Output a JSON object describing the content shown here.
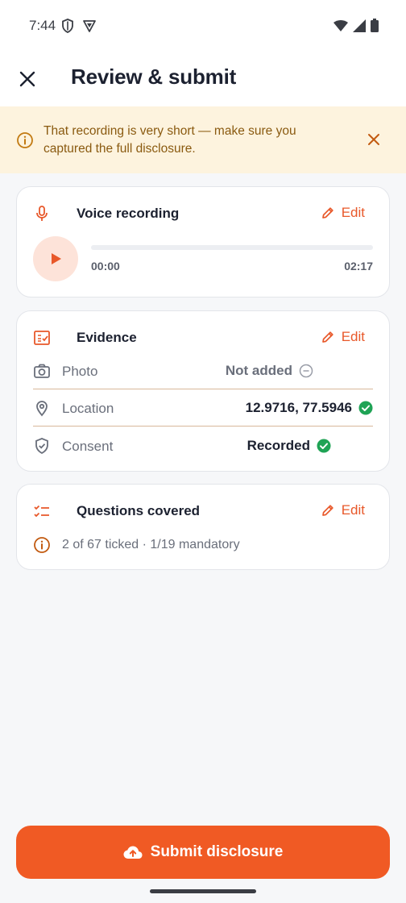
{
  "status_bar": {
    "time": "7:44"
  },
  "header": {
    "title": "Review & submit"
  },
  "banner": {
    "message": "That recording is very short — make sure you captured the full disclosure."
  },
  "voice_card": {
    "title": "Voice recording",
    "edit_label": "Edit",
    "time_elapsed": "00:00",
    "time_total": "02:17",
    "progress": 0
  },
  "evidence_card": {
    "title": "Evidence",
    "edit_label": "Edit",
    "rows": [
      {
        "label": "Photo",
        "value": "Not added",
        "status": "missing"
      },
      {
        "label": "Location",
        "value": "12.9716, 77.5946",
        "status": "ok"
      },
      {
        "label": "Consent",
        "value": "Recorded",
        "status": "ok"
      }
    ]
  },
  "questions_card": {
    "title": "Questions covered",
    "edit_label": "Edit",
    "summary": "2 of 67 ticked · 1/19 mandatory"
  },
  "submit": {
    "label": "Submit disclosure"
  },
  "colors": {
    "accent": "#f05a24",
    "success": "#1fa355",
    "warning_bg": "#fdf3de"
  }
}
